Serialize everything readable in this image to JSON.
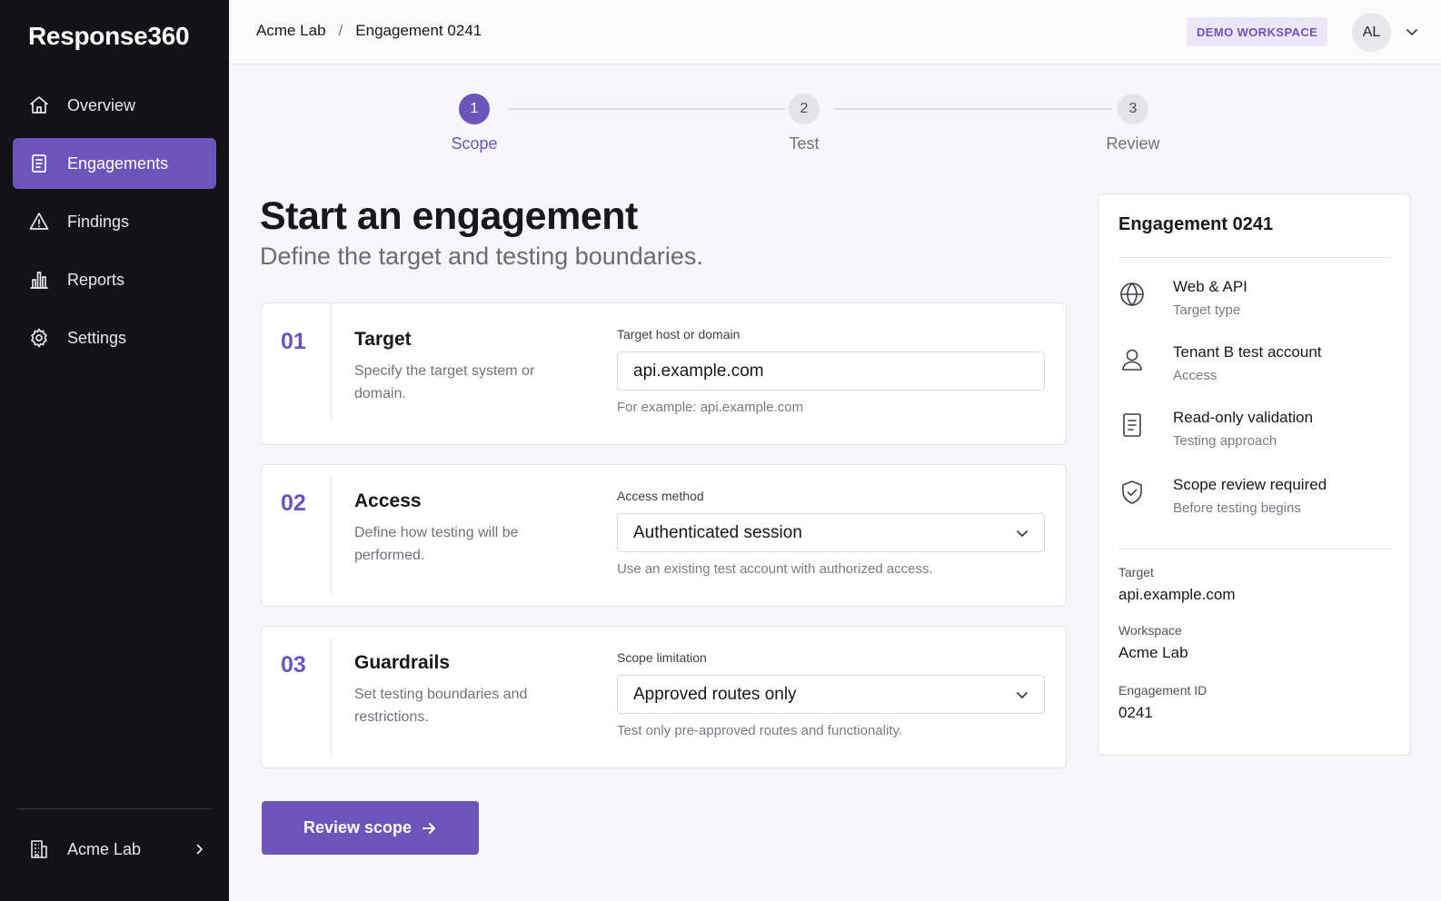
{
  "app": {
    "brand": "Response360"
  },
  "sidebar": {
    "items": [
      {
        "label": "Overview",
        "icon": "home-icon",
        "active": false
      },
      {
        "label": "Engagements",
        "icon": "document-icon",
        "active": true
      },
      {
        "label": "Findings",
        "icon": "warning-icon",
        "active": false
      },
      {
        "label": "Reports",
        "icon": "bar-chart-icon",
        "active": false
      },
      {
        "label": "Settings",
        "icon": "gear-icon",
        "active": false
      }
    ],
    "org": {
      "label": "Acme Lab",
      "icon": "building-icon"
    }
  },
  "header": {
    "breadcrumb": [
      "Acme Lab",
      "Engagement 0241"
    ],
    "breadcrumb_sep": "/",
    "workspace_badge": "DEMO WORKSPACE",
    "avatar_initials": "AL"
  },
  "stepper": {
    "steps": [
      {
        "number": "1",
        "label": "Scope",
        "active": true
      },
      {
        "number": "2",
        "label": "Test",
        "active": false
      },
      {
        "number": "3",
        "label": "Review",
        "active": false
      }
    ]
  },
  "page": {
    "title": "Start an engagement",
    "subtitle": "Define the target and testing boundaries."
  },
  "sections": [
    {
      "number": "01",
      "title": "Target",
      "description": "Specify the target system or domain.",
      "field_label": "Target host or domain",
      "field_value": "api.example.com",
      "field_type": "text",
      "hint": "For example: api.example.com"
    },
    {
      "number": "02",
      "title": "Access",
      "description": "Define how testing will be performed.",
      "field_label": "Access method",
      "field_value": "Authenticated session",
      "field_type": "select",
      "hint": "Use an existing test account with authorized access."
    },
    {
      "number": "03",
      "title": "Guardrails",
      "description": "Set testing boundaries and restrictions.",
      "field_label": "Scope limitation",
      "field_value": "Approved routes only",
      "field_type": "select",
      "hint": "Test only pre-approved routes and functionality."
    }
  ],
  "actions": {
    "primary_label": "Review scope"
  },
  "summary": {
    "title": "Engagement 0241",
    "items": [
      {
        "icon": "globe-icon",
        "main": "Web & API",
        "sub": "Target type"
      },
      {
        "icon": "user-icon",
        "main": "Tenant B test account",
        "sub": "Access"
      },
      {
        "icon": "document-icon",
        "main": "Read-only validation",
        "sub": "Testing approach"
      },
      {
        "icon": "shield-check-icon",
        "main": "Scope review required",
        "sub": "Before testing begins"
      }
    ],
    "meta": [
      {
        "label": "Target",
        "value": "api.example.com"
      },
      {
        "label": "Workspace",
        "value": "Acme Lab"
      },
      {
        "label": "Engagement ID",
        "value": "0241"
      }
    ]
  },
  "colors": {
    "accent": "#6b55bb",
    "sidebar_bg": "#131317",
    "page_bg": "#f7f7f9",
    "badge_bg": "#ebe7f8"
  }
}
